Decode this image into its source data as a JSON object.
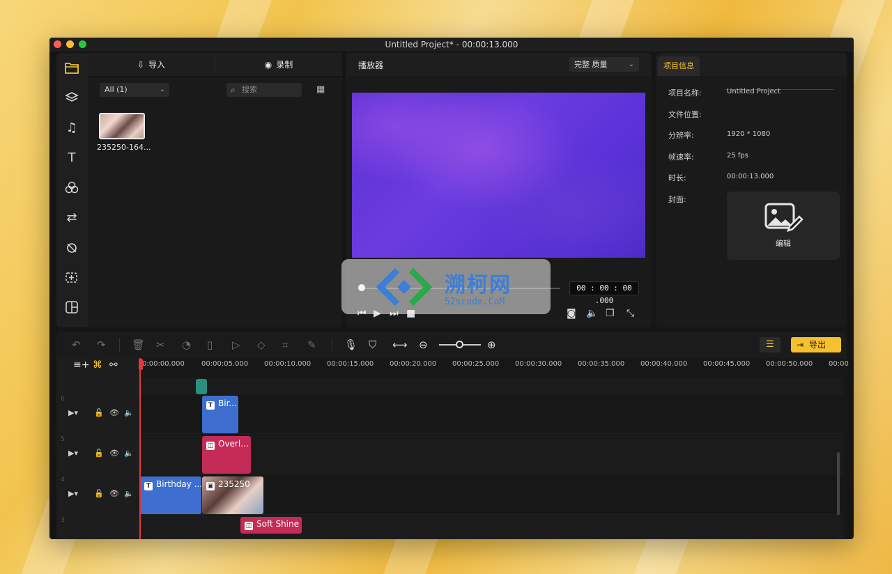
{
  "window": {
    "title": "Untitled Project* - 00:00:13.000"
  },
  "media": {
    "import_label": "导入",
    "record_label": "录制",
    "filter_value": "All (1)",
    "search_placeholder": "搜索",
    "thumbnail_name": "235250-164..."
  },
  "player": {
    "title": "播放器",
    "quality": "完整 质量",
    "timecode": "00 : 00 : 00 .000"
  },
  "info": {
    "tab_label": "项目信息",
    "rows": [
      {
        "label": "项目名称:",
        "value": "Untitled Project"
      },
      {
        "label": "文件位置:",
        "value": ""
      },
      {
        "label": "分辨率:",
        "value": "1920 * 1080"
      },
      {
        "label": "帧速率:",
        "value": "25 fps"
      },
      {
        "label": "时长:",
        "value": "00:00:13.000"
      },
      {
        "label": "封面:",
        "value": ""
      }
    ],
    "cover_edit": "编辑"
  },
  "toolbar": {
    "export_label": "导出"
  },
  "ruler": {
    "ticks": [
      "0:00:00.000",
      "00:00:05.000",
      "00:00:10.000",
      "00:00:15.000",
      "00:00:20.000",
      "00:00:25.000",
      "00:00:30.000",
      "00:00:35.000",
      "00:00:40.000",
      "00:00:45.000",
      "00:00:50.000",
      "00:00"
    ]
  },
  "tracks": {
    "lane_numbers": [
      "6",
      "5",
      "4",
      "3"
    ],
    "clips": {
      "track6_text": "Bir...",
      "track5_overlay": "Overl...",
      "track4_text": "Birthday ...",
      "track4_image": "235250",
      "track3_effect": "Soft Shine"
    }
  },
  "watermark": {
    "title": "溯柯网",
    "subtitle": "52scode.CoM"
  },
  "colors": {
    "accent": "#f5c22e",
    "clip_blue": "#3d6ed0",
    "clip_pink": "#c42b56",
    "playhead": "#e0393c"
  }
}
